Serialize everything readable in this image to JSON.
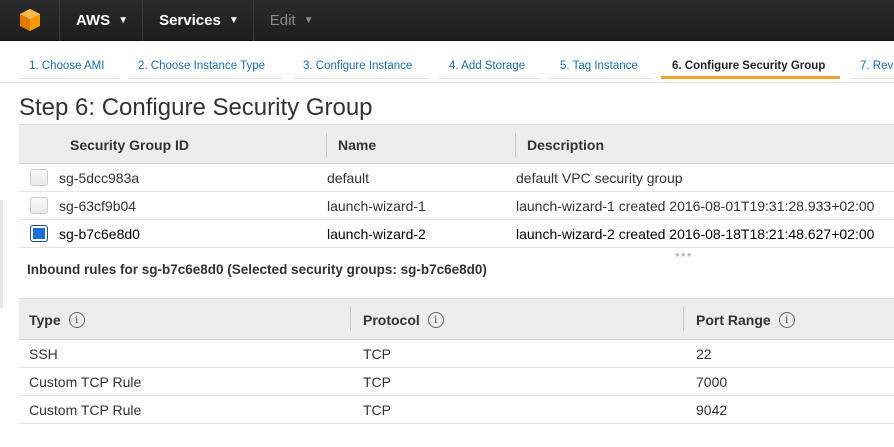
{
  "topnav": {
    "brand": "AWS",
    "services": "Services",
    "edit": "Edit"
  },
  "wizard": {
    "steps": [
      "1. Choose AMI",
      "2. Choose Instance Type",
      "3. Configure Instance",
      "4. Add Storage",
      "5. Tag Instance",
      "6. Configure Security Group",
      "7. Rev"
    ],
    "active_index": 5
  },
  "page": {
    "title": "Step 6: Configure Security Group"
  },
  "security_groups": {
    "headers": [
      "Security Group ID",
      "Name",
      "Description"
    ],
    "rows": [
      {
        "id": "sg-5dcc983a",
        "name": "default",
        "description": "default VPC security group",
        "checked": false
      },
      {
        "id": "sg-63cf9b04",
        "name": "launch-wizard-1",
        "description": "launch-wizard-1 created 2016-08-01T19:31:28.933+02:00",
        "checked": false
      },
      {
        "id": "sg-b7c6e8d0",
        "name": "launch-wizard-2",
        "description": "launch-wizard-2 created 2016-08-18T18:21:48.627+02:00",
        "checked": true
      }
    ]
  },
  "inbound": {
    "title": "Inbound rules for sg-b7c6e8d0 (Selected security groups: sg-b7c6e8d0)"
  },
  "rules": {
    "headers": [
      "Type",
      "Protocol",
      "Port Range"
    ],
    "rows": [
      {
        "type": "SSH",
        "protocol": "TCP",
        "port": "22"
      },
      {
        "type": "Custom TCP Rule",
        "protocol": "TCP",
        "port": "7000"
      },
      {
        "type": "Custom TCP Rule",
        "protocol": "TCP",
        "port": "9042"
      }
    ]
  },
  "icons": {
    "logo": "aws-cube-icon",
    "caret": "chevron-down-icon",
    "info": "info-icon",
    "checkbox": "checkbox-icon"
  },
  "colors": {
    "topbar": "#232323",
    "link": "#1a6fb0",
    "active_tab_underline": "#f0a22b",
    "checkbox_checked": "#1a6fdb"
  }
}
